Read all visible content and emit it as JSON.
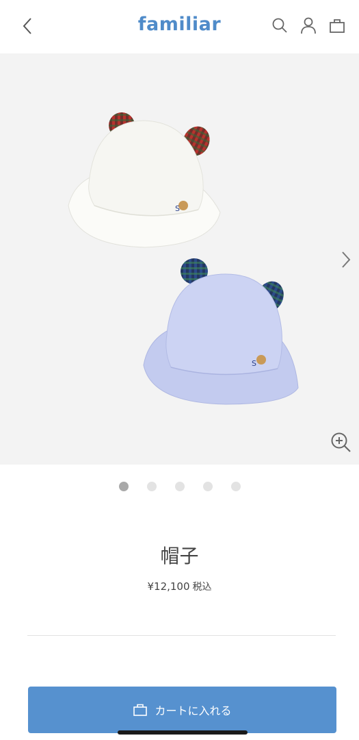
{
  "header": {
    "logo": "familiar",
    "icons": [
      "back-chevron-icon",
      "search-icon",
      "account-icon",
      "shopping-bag-icon"
    ]
  },
  "gallery": {
    "image_alt": "帽子",
    "total_images": 5,
    "active_index": 0,
    "icons": [
      "chevron-right-icon",
      "zoom-in-icon"
    ]
  },
  "product": {
    "title": "帽子",
    "price": "¥12,100",
    "tax_label": "税込"
  },
  "cart": {
    "button_label": "カートに入れる",
    "icon": "cart-bag-icon"
  },
  "colors": {
    "brand": "#4f8bc9",
    "button": "#5691cf",
    "gallery_bg": "#f3f3f3"
  }
}
